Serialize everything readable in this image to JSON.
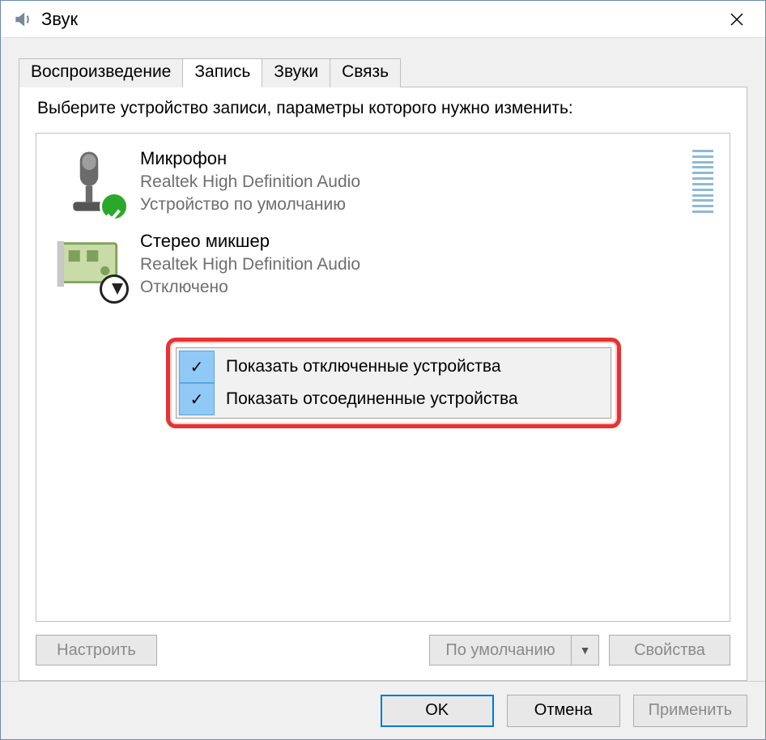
{
  "window": {
    "title": "Звук"
  },
  "tabs": [
    {
      "label": "Воспроизведение",
      "active": false
    },
    {
      "label": "Запись",
      "active": true
    },
    {
      "label": "Звуки",
      "active": false
    },
    {
      "label": "Связь",
      "active": false
    }
  ],
  "panel": {
    "instruction": "Выберите устройство записи, параметры которого нужно изменить:",
    "devices": [
      {
        "icon": "microphone-icon",
        "badge": "default-check",
        "name": "Микрофон",
        "driver": "Realtek High Definition Audio",
        "status": "Устройство по умолчанию",
        "has_meter": true
      },
      {
        "icon": "sound-card-icon",
        "badge": "disabled-arrow",
        "name": "Стерео микшер",
        "driver": "Realtek High Definition Audio",
        "status": "Отключено",
        "has_meter": false
      }
    ],
    "context_menu": [
      {
        "label": "Показать отключенные устройства",
        "checked": true
      },
      {
        "label": "Показать отсоединенные устройства",
        "checked": true
      }
    ],
    "buttons": {
      "configure": "Настроить",
      "set_default": "По умолчанию",
      "properties": "Свойства"
    }
  },
  "footer": {
    "ok": "OK",
    "cancel": "Отмена",
    "apply": "Применить"
  }
}
